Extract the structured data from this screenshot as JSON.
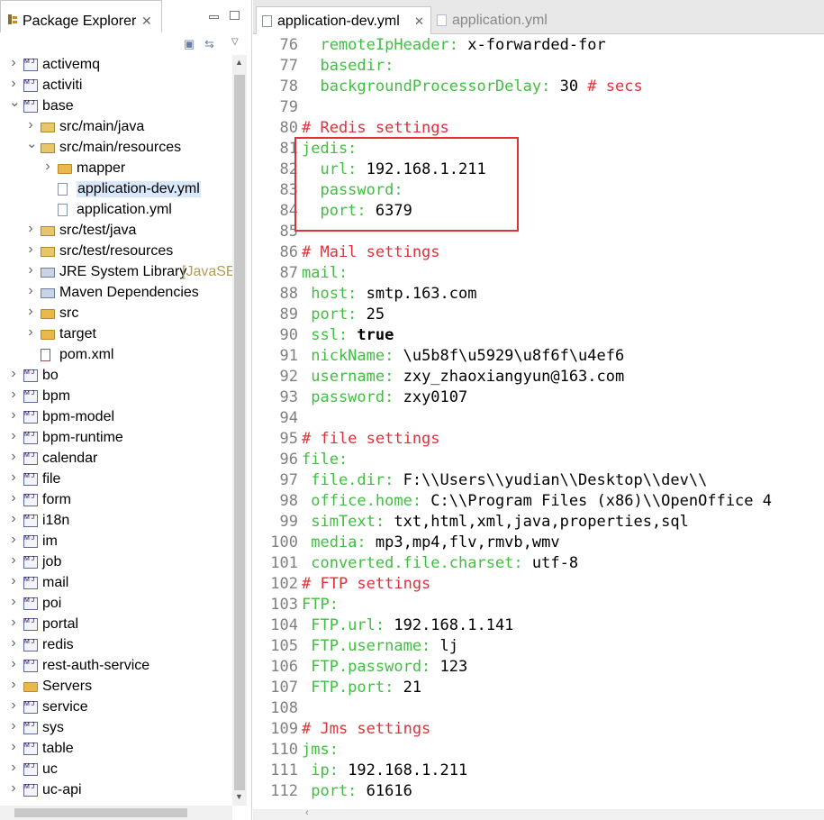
{
  "package_explorer": {
    "title": "Package Explorer",
    "tree": [
      {
        "label": "activemq",
        "icon": "project-icon",
        "expanded": false,
        "level": 0
      },
      {
        "label": "activiti",
        "icon": "project-icon",
        "expanded": false,
        "level": 0
      },
      {
        "label": "base",
        "icon": "project-icon",
        "expanded": true,
        "level": 0
      },
      {
        "label": "src/main/java",
        "icon": "source-folder-icon",
        "expanded": false,
        "level": 1
      },
      {
        "label": "src/main/resources",
        "icon": "source-folder-icon",
        "expanded": true,
        "level": 1
      },
      {
        "label": "mapper",
        "icon": "folder-icon",
        "expanded": false,
        "level": 2
      },
      {
        "label": "application-dev.yml",
        "icon": "file-icon",
        "level": 2,
        "selected": true
      },
      {
        "label": "application.yml",
        "icon": "file-icon",
        "level": 2
      },
      {
        "label": "src/test/java",
        "icon": "source-folder-icon",
        "expanded": false,
        "level": 1
      },
      {
        "label": "src/test/resources",
        "icon": "source-folder-icon",
        "expanded": false,
        "level": 1
      },
      {
        "label": "JRE System Library",
        "decoration": "[JavaSE",
        "icon": "library-icon",
        "expanded": false,
        "level": 1
      },
      {
        "label": "Maven Dependencies",
        "icon": "library-icon",
        "expanded": false,
        "level": 1
      },
      {
        "label": "src",
        "icon": "folder-icon",
        "expanded": false,
        "level": 1
      },
      {
        "label": "target",
        "icon": "folder-icon",
        "expanded": false,
        "level": 1
      },
      {
        "label": "pom.xml",
        "icon": "maven-file-icon",
        "level": 1
      },
      {
        "label": "bo",
        "icon": "project-icon",
        "expanded": false,
        "level": 0
      },
      {
        "label": "bpm",
        "icon": "project-icon",
        "expanded": false,
        "level": 0
      },
      {
        "label": "bpm-model",
        "icon": "project-icon",
        "expanded": false,
        "level": 0
      },
      {
        "label": "bpm-runtime",
        "icon": "project-icon",
        "expanded": false,
        "level": 0
      },
      {
        "label": "calendar",
        "icon": "project-icon",
        "expanded": false,
        "level": 0
      },
      {
        "label": "file",
        "icon": "project-icon",
        "expanded": false,
        "level": 0
      },
      {
        "label": "form",
        "icon": "project-icon",
        "expanded": false,
        "level": 0
      },
      {
        "label": "i18n",
        "icon": "project-icon",
        "expanded": false,
        "level": 0
      },
      {
        "label": "im",
        "icon": "project-icon",
        "expanded": false,
        "level": 0
      },
      {
        "label": "job",
        "icon": "project-icon",
        "expanded": false,
        "level": 0
      },
      {
        "label": "mail",
        "icon": "project-icon",
        "expanded": false,
        "level": 0
      },
      {
        "label": "poi",
        "icon": "project-icon",
        "expanded": false,
        "level": 0
      },
      {
        "label": "portal",
        "icon": "project-icon",
        "expanded": false,
        "level": 0
      },
      {
        "label": "redis",
        "icon": "project-icon",
        "expanded": false,
        "level": 0
      },
      {
        "label": "rest-auth-service",
        "icon": "project-icon",
        "expanded": false,
        "level": 0
      },
      {
        "label": "Servers",
        "icon": "folder-icon",
        "expanded": false,
        "level": 0
      },
      {
        "label": "service",
        "icon": "project-icon",
        "expanded": false,
        "level": 0
      },
      {
        "label": "sys",
        "icon": "project-icon",
        "expanded": false,
        "level": 0
      },
      {
        "label": "table",
        "icon": "project-icon",
        "expanded": false,
        "level": 0
      },
      {
        "label": "uc",
        "icon": "project-icon",
        "expanded": false,
        "level": 0
      },
      {
        "label": "uc-api",
        "icon": "project-icon",
        "expanded": false,
        "level": 0
      }
    ]
  },
  "editor": {
    "tabs": [
      {
        "label": "application-dev.yml",
        "active": true
      },
      {
        "label": "application.yml",
        "active": false
      }
    ],
    "lines": [
      {
        "n": "76",
        "parts": [
          [
            "k",
            "  remoteIpHeader: "
          ],
          [
            "v",
            "x-forwarded-for"
          ]
        ]
      },
      {
        "n": "77",
        "parts": [
          [
            "k",
            "  basedir:"
          ]
        ]
      },
      {
        "n": "78",
        "parts": [
          [
            "k",
            "  backgroundProcessorDelay: "
          ],
          [
            "v",
            "30 "
          ],
          [
            "c",
            "# secs"
          ]
        ]
      },
      {
        "n": "79",
        "parts": []
      },
      {
        "n": "80",
        "parts": [
          [
            "c",
            "# Redis settings"
          ]
        ]
      },
      {
        "n": "81",
        "parts": [
          [
            "k",
            "jedis:"
          ]
        ]
      },
      {
        "n": "82",
        "parts": [
          [
            "k",
            "  url: "
          ],
          [
            "v",
            "192.168.1.211"
          ]
        ]
      },
      {
        "n": "83",
        "parts": [
          [
            "k",
            "  password:"
          ]
        ]
      },
      {
        "n": "84",
        "parts": [
          [
            "k",
            "  port: "
          ],
          [
            "v",
            "6379"
          ]
        ]
      },
      {
        "n": "85",
        "parts": []
      },
      {
        "n": "86",
        "parts": [
          [
            "c",
            "# Mail settings"
          ]
        ]
      },
      {
        "n": "87",
        "parts": [
          [
            "k",
            "mail:"
          ]
        ]
      },
      {
        "n": "88",
        "parts": [
          [
            "k",
            " host: "
          ],
          [
            "v",
            "smtp.163.com"
          ]
        ]
      },
      {
        "n": "89",
        "parts": [
          [
            "k",
            " port: "
          ],
          [
            "v",
            "25"
          ]
        ]
      },
      {
        "n": "90",
        "parts": [
          [
            "k",
            " ssl: "
          ],
          [
            "b",
            "true"
          ]
        ]
      },
      {
        "n": "91",
        "parts": [
          [
            "k",
            " nickName: "
          ],
          [
            "v",
            "\\u5b8f\\u5929\\u8f6f\\u4ef6"
          ]
        ]
      },
      {
        "n": "92",
        "parts": [
          [
            "k",
            " username: "
          ],
          [
            "v",
            "zxy_zhaoxiangyun@163.com"
          ]
        ]
      },
      {
        "n": "93",
        "parts": [
          [
            "k",
            " password: "
          ],
          [
            "v",
            "zxy0107"
          ]
        ]
      },
      {
        "n": "94",
        "parts": []
      },
      {
        "n": "95",
        "parts": [
          [
            "c",
            "# file settings"
          ]
        ]
      },
      {
        "n": "96",
        "parts": [
          [
            "k",
            "file:"
          ]
        ]
      },
      {
        "n": "97",
        "parts": [
          [
            "k",
            " file.dir: "
          ],
          [
            "v",
            "F:\\\\Users\\\\yudian\\\\Desktop\\\\dev\\\\"
          ]
        ]
      },
      {
        "n": "98",
        "parts": [
          [
            "k",
            " office.home: "
          ],
          [
            "v",
            "C:\\\\Program Files (x86)\\\\OpenOffice 4"
          ]
        ]
      },
      {
        "n": "99",
        "parts": [
          [
            "k",
            " simText: "
          ],
          [
            "v",
            "txt,html,xml,java,properties,sql"
          ]
        ]
      },
      {
        "n": "100",
        "parts": [
          [
            "k",
            " media: "
          ],
          [
            "v",
            "mp3,mp4,flv,rmvb,wmv"
          ]
        ]
      },
      {
        "n": "101",
        "parts": [
          [
            "k",
            " converted.file.charset: "
          ],
          [
            "v",
            "utf-8"
          ]
        ]
      },
      {
        "n": "102",
        "parts": [
          [
            "c",
            "# FTP settings"
          ]
        ]
      },
      {
        "n": "103",
        "parts": [
          [
            "k",
            "FTP:"
          ]
        ]
      },
      {
        "n": "104",
        "parts": [
          [
            "k",
            " FTP.url: "
          ],
          [
            "v",
            "192.168.1.141"
          ]
        ]
      },
      {
        "n": "105",
        "parts": [
          [
            "k",
            " FTP.username: "
          ],
          [
            "v",
            "lj"
          ]
        ]
      },
      {
        "n": "106",
        "parts": [
          [
            "k",
            " FTP.password: "
          ],
          [
            "v",
            "123"
          ]
        ]
      },
      {
        "n": "107",
        "parts": [
          [
            "k",
            " FTP.port: "
          ],
          [
            "v",
            "21"
          ]
        ]
      },
      {
        "n": "108",
        "parts": []
      },
      {
        "n": "109",
        "parts": [
          [
            "c",
            "# Jms settings"
          ]
        ]
      },
      {
        "n": "110",
        "parts": [
          [
            "k",
            "jms:"
          ]
        ]
      },
      {
        "n": "111",
        "parts": [
          [
            "k",
            " ip: "
          ],
          [
            "v",
            "192.168.1.211"
          ]
        ]
      },
      {
        "n": "112",
        "parts": [
          [
            "k",
            " port: "
          ],
          [
            "v",
            "61616"
          ]
        ]
      }
    ]
  },
  "colors": {
    "key": "#3fbf3f",
    "comment": "#e0303a",
    "highlight_box": "#e0303a",
    "selection": "#d9e9fb"
  }
}
